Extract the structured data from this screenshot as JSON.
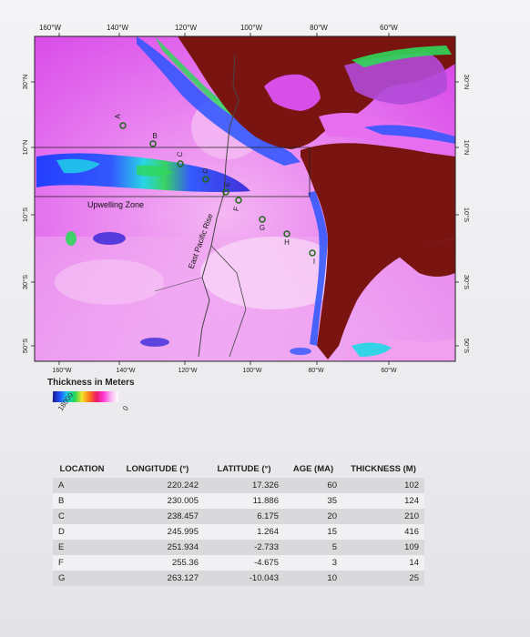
{
  "map": {
    "top_longitudes": [
      "160°W",
      "140°W",
      "120°W",
      "100°W",
      "80°W",
      "60°W"
    ],
    "bottom_longitudes": [
      "160°W",
      "140°W",
      "120°W",
      "100°W",
      "80°W",
      "60°W"
    ],
    "left_latitudes": [
      "30°N",
      "10°N",
      "10°S",
      "30°S",
      "50°S"
    ],
    "right_latitudes": [
      "30°N",
      "10°N",
      "10°S",
      "30°S",
      "50°S"
    ],
    "site_labels": [
      "A",
      "B",
      "C",
      "D",
      "E",
      "F",
      "G",
      "H",
      "I"
    ],
    "upwelling_label": "Upwelling Zone",
    "ridge_label": "East Pacific Rise",
    "colors": {
      "ocean_pink": "#e86ef0",
      "ocean_light": "#f6c8f4",
      "land": "#7a1410",
      "upwelling_blue": "#2a4bff",
      "upwelling_cyan": "#1fd8e6",
      "upwelling_green": "#2fd65a"
    }
  },
  "legend": {
    "title": "Thickness in Meters",
    "low_label": "18000",
    "high_label": "0"
  },
  "table": {
    "headers": {
      "location": "LOCATION",
      "longitude": "LONGITUDE (°)",
      "latitude": "LATITUDE (°)",
      "age": "AGE (MA)",
      "thickness": "THICKNESS (M)"
    },
    "rows": [
      {
        "location": "A",
        "longitude": "220.242",
        "latitude": "17.326",
        "age": "60",
        "thickness": "102"
      },
      {
        "location": "B",
        "longitude": "230.005",
        "latitude": "11.886",
        "age": "35",
        "thickness": "124"
      },
      {
        "location": "C",
        "longitude": "238.457",
        "latitude": "6.175",
        "age": "20",
        "thickness": "210"
      },
      {
        "location": "D",
        "longitude": "245.995",
        "latitude": "1.264",
        "age": "15",
        "thickness": "416"
      },
      {
        "location": "E",
        "longitude": "251.934",
        "latitude": "-2.733",
        "age": "5",
        "thickness": "109"
      },
      {
        "location": "F",
        "longitude": "255.36",
        "latitude": "-4.675",
        "age": "3",
        "thickness": "14"
      },
      {
        "location": "G",
        "longitude": "263.127",
        "latitude": "-10.043",
        "age": "10",
        "thickness": "25"
      }
    ]
  }
}
